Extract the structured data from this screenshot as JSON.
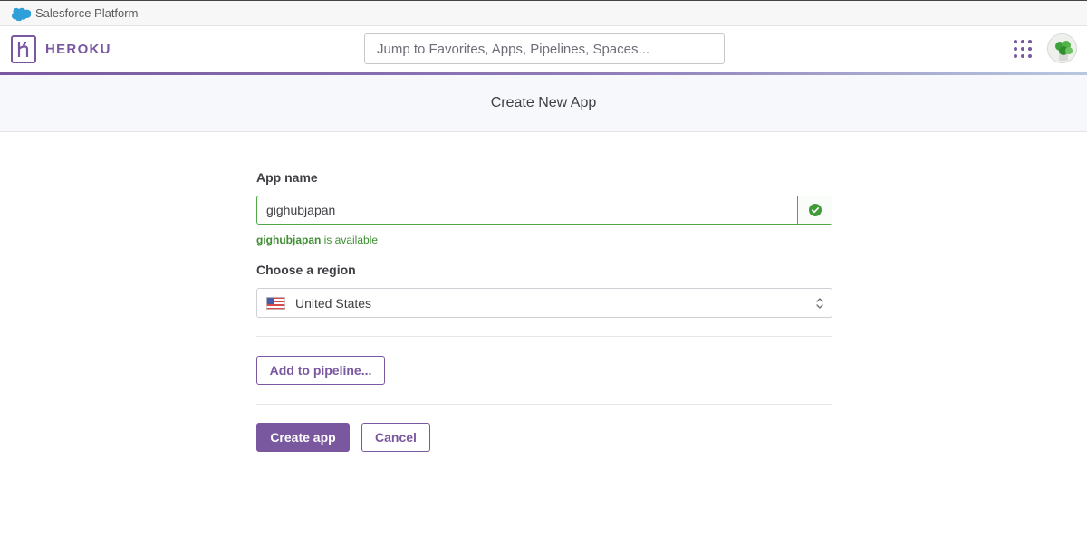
{
  "salesforce_bar": {
    "label": "Salesforce Platform"
  },
  "header": {
    "brand": "HEROKU",
    "search_placeholder": "Jump to Favorites, Apps, Pipelines, Spaces..."
  },
  "page": {
    "title": "Create New App"
  },
  "form": {
    "app_name_label": "App name",
    "app_name_value": "gighubjapan",
    "availability_name": "gighubjapan",
    "availability_suffix": " is available",
    "region_label": "Choose a region",
    "region_value": "United States"
  },
  "buttons": {
    "add_pipeline": "Add to pipeline...",
    "create": "Create app",
    "cancel": "Cancel"
  },
  "colors": {
    "brand_purple": "#79589f",
    "success_green": "#52a548"
  },
  "icons": [
    "salesforce-cloud-icon",
    "heroku-logo-icon",
    "apps-grid-icon",
    "checkmark-icon",
    "us-flag-icon",
    "select-chevrons-icon"
  ]
}
